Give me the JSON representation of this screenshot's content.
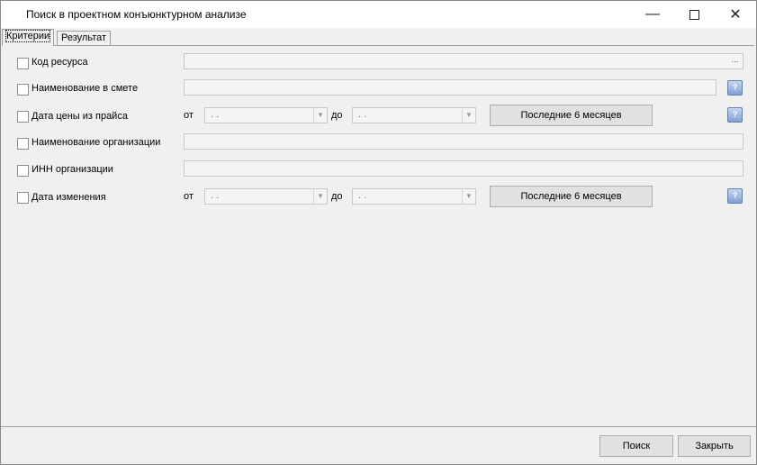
{
  "window": {
    "title": "Поиск в проектном конъюнктурном анализе",
    "minimize_icon": "minimize-icon",
    "maximize_icon": "maximize-icon",
    "close_icon": "close-icon"
  },
  "tabs": [
    {
      "label": "Критерии",
      "active": true
    },
    {
      "label": "Результат",
      "active": false
    }
  ],
  "criteria": {
    "resource_code": {
      "label": "Код ресурса",
      "checked": false,
      "value": "",
      "browse": "..."
    },
    "estimate_name": {
      "label": "Наименование в смете",
      "checked": false,
      "value": "",
      "help": "?"
    },
    "price_date": {
      "label": "Дата цены из прайса",
      "checked": false,
      "from_label": "от",
      "from_value": ". .",
      "to_label": "до",
      "to_value": ". .",
      "last6_label": "Последние 6 месяцев",
      "help": "?"
    },
    "org_name": {
      "label": "Наименование организации",
      "checked": false,
      "value": ""
    },
    "org_inn": {
      "label": "ИНН организации",
      "checked": false,
      "value": ""
    },
    "change_date": {
      "label": "Дата изменения",
      "checked": false,
      "from_label": "от",
      "from_value": ". .",
      "to_label": "до",
      "to_value": ". .",
      "last6_label": "Последние 6 месяцев",
      "help": "?"
    }
  },
  "footer": {
    "search_label": "Поиск",
    "close_label": "Закрыть"
  }
}
